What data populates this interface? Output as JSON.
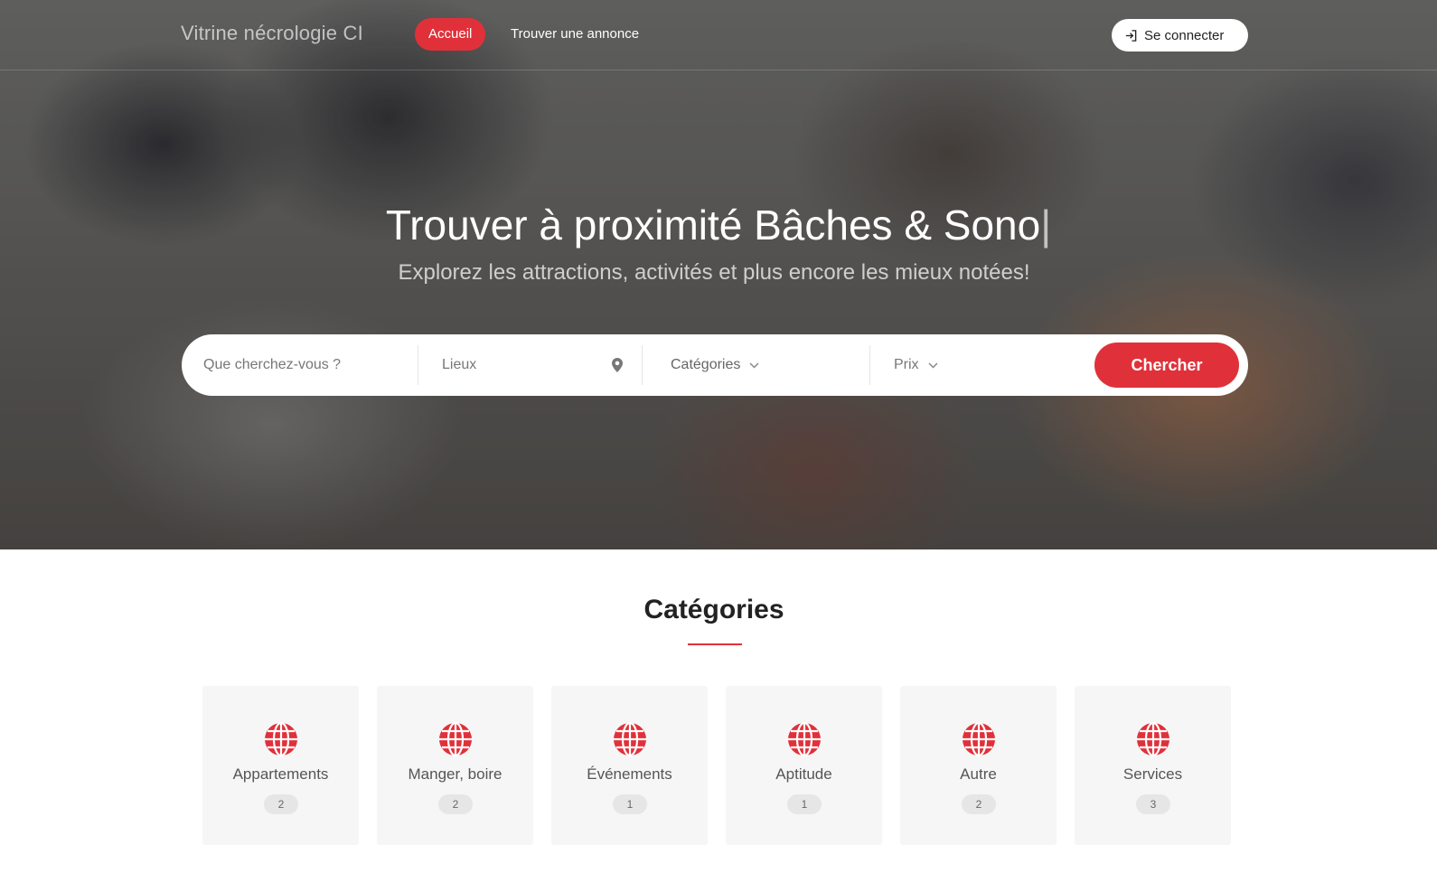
{
  "nav": {
    "brand": "Vitrine nécrologie CI",
    "home": "Accueil",
    "find": "Trouver une annonce",
    "login": "Se connecter"
  },
  "hero": {
    "title": "Trouver à proximité Bâches & Sono",
    "cursor": "|",
    "subtitle": "Explorez les attractions, activités et plus encore les mieux notées!"
  },
  "search": {
    "what_placeholder": "Que cherchez-vous ?",
    "where": "Lieux",
    "categories": "Catégories",
    "price": "Prix",
    "button": "Chercher"
  },
  "categories": {
    "title": "Catégories",
    "items": [
      {
        "label": "Appartements",
        "count": "2"
      },
      {
        "label": "Manger, boire",
        "count": "2"
      },
      {
        "label": "Événements",
        "count": "1"
      },
      {
        "label": "Aptitude",
        "count": "1"
      },
      {
        "label": "Autre",
        "count": "2"
      },
      {
        "label": "Services",
        "count": "3"
      }
    ]
  },
  "colors": {
    "accent": "#e0313a"
  },
  "icons": {
    "login": "login-icon",
    "location": "map-pin-icon",
    "dropdown": "chevron-down-icon",
    "category": "globe-icon"
  }
}
